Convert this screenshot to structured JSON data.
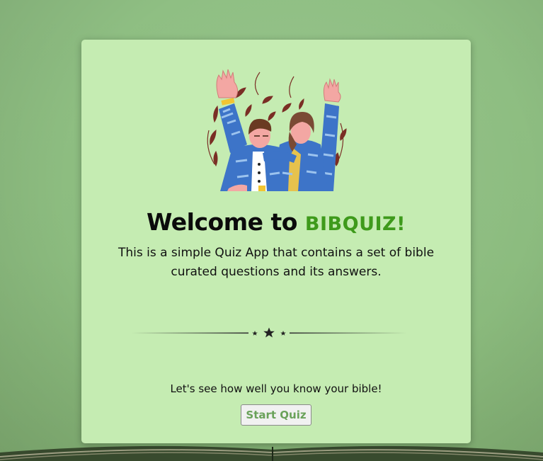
{
  "welcome": {
    "heading_prefix": "Welcome to",
    "brand": "BIBQUIZ!",
    "description": "This is a simple Quiz App that contains a set of bible curated questions and its answers."
  },
  "footer": {
    "prompt": "Let's see how well you know your bible!",
    "start_button_label": "Start Quiz"
  },
  "colors": {
    "card_background": "#c5ecb2",
    "brand_accent": "#3e9a1b",
    "page_background": "#8cbc7f"
  },
  "icons": {
    "hero": "celebrating-couple-illustration",
    "divider": "star-divider-icon"
  }
}
